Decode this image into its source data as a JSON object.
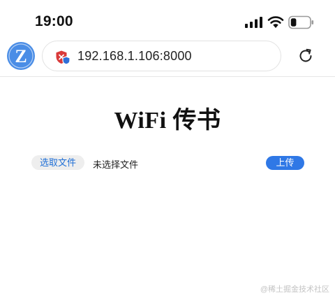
{
  "status_bar": {
    "time": "19:00",
    "battery_level": 0.3,
    "icons": [
      "signal-icon",
      "wifi-icon",
      "battery-icon"
    ]
  },
  "browser": {
    "logo_letter": "Z",
    "url": "192.168.1.106:8000",
    "icons": [
      "shield-icon",
      "reload-icon"
    ]
  },
  "main": {
    "title": "WiFi 传书",
    "file_button_label": "选取文件",
    "file_status": "未选择文件",
    "upload_label": "上传"
  },
  "watermark": "@稀土掘金技术社区",
  "colors": {
    "accent": "#2f78e6",
    "link": "#1f6fd6",
    "logo_bg": "#4a8de6",
    "shield_red": "#d93a3a"
  }
}
